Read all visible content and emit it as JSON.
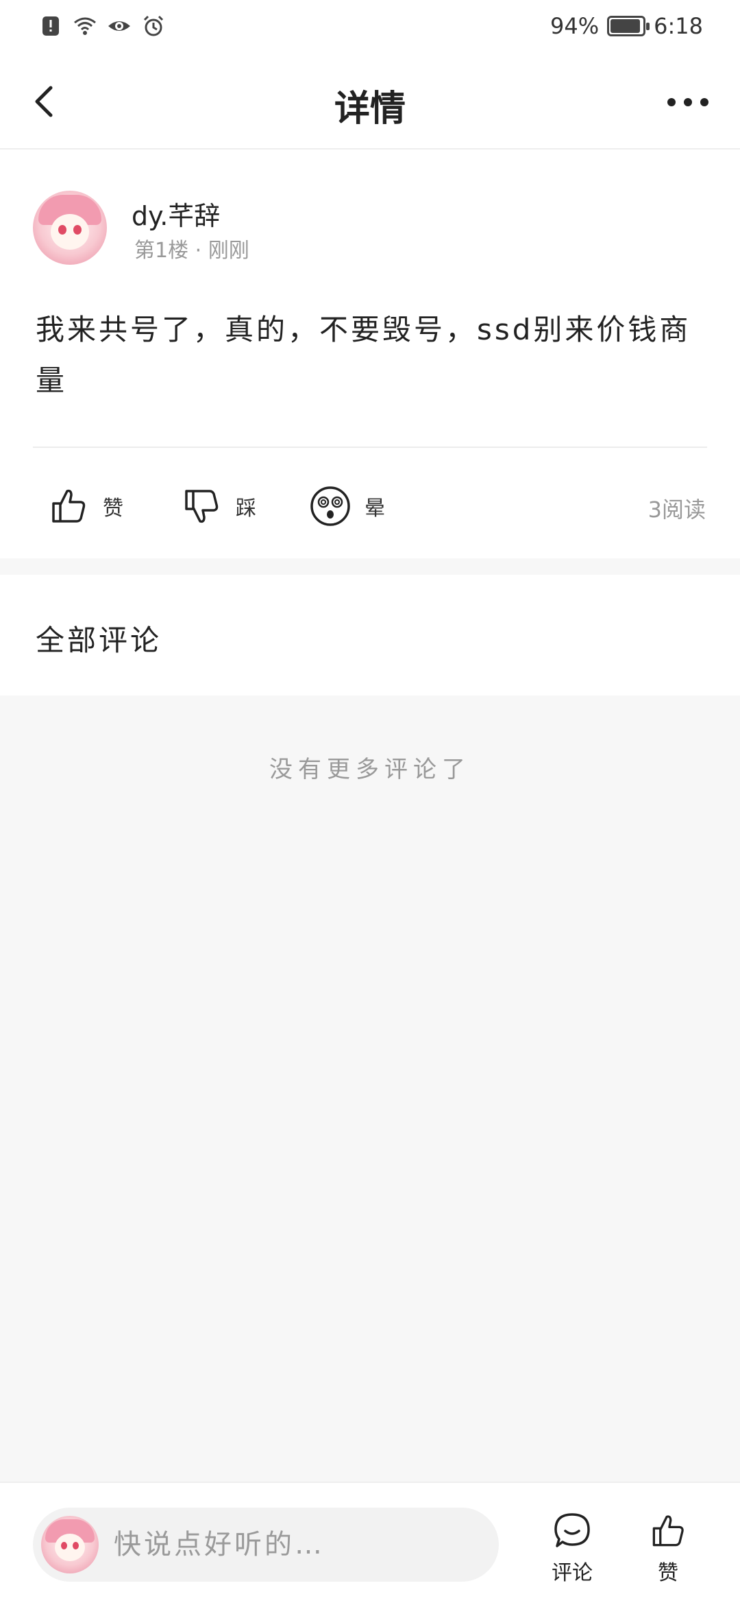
{
  "status_bar": {
    "battery": "94%",
    "time": "6:18",
    "battery_level": 0.94,
    "icons": [
      "notification-icon",
      "wifi-icon",
      "eye-icon",
      "alarm-icon"
    ]
  },
  "header": {
    "title": "详情",
    "back_icon": "chevron-left-icon",
    "more_icon": "more-dots-icon"
  },
  "post": {
    "author": "dy.芊辞",
    "meta": "第1楼 · 刚刚",
    "content": "我来共号了，真的，不要毁号，ssd别来价钱商量",
    "actions": {
      "like_label": "赞",
      "dislike_label": "踩",
      "dizzy_label": "晕"
    },
    "read_count": "3阅读"
  },
  "comments": {
    "title": "全部评论",
    "empty_text": "没有更多评论了"
  },
  "bottom_bar": {
    "input_placeholder": "快说点好听的…",
    "comment_label": "评论",
    "like_label": "赞"
  },
  "colors": {
    "background": "#f7f7f7",
    "surface": "#ffffff",
    "text": "#222222",
    "muted": "#999999"
  }
}
